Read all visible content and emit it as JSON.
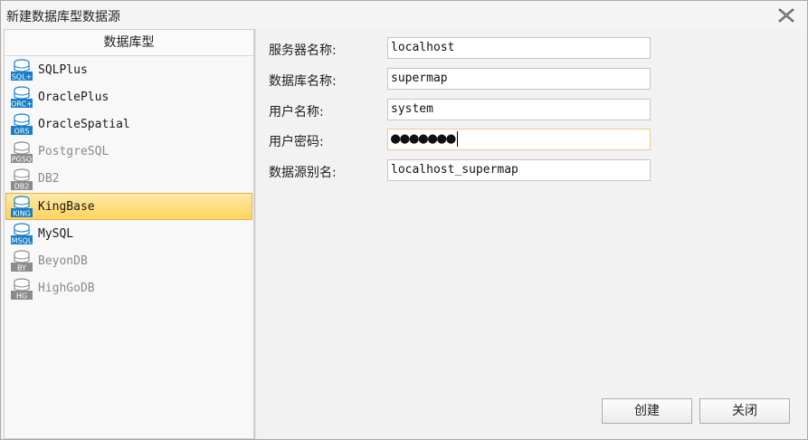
{
  "window": {
    "title": "新建数据库型数据源"
  },
  "left_panel": {
    "header": "数据库型",
    "items": [
      {
        "label": "SQLPlus",
        "badge": "SQL+",
        "enabled": true,
        "selected": false
      },
      {
        "label": "OraclePlus",
        "badge": "ORC+",
        "enabled": true,
        "selected": false
      },
      {
        "label": "OracleSpatial",
        "badge": "ORS",
        "enabled": true,
        "selected": false
      },
      {
        "label": "PostgreSQL",
        "badge": "PGSQ",
        "enabled": false,
        "selected": false
      },
      {
        "label": "DB2",
        "badge": "DB2",
        "enabled": false,
        "selected": false
      },
      {
        "label": "KingBase",
        "badge": "KING",
        "enabled": true,
        "selected": true
      },
      {
        "label": "MySQL",
        "badge": "MSQL",
        "enabled": true,
        "selected": false
      },
      {
        "label": "BeyonDB",
        "badge": "BY",
        "enabled": false,
        "selected": false
      },
      {
        "label": "HighGoDB",
        "badge": "HG",
        "enabled": false,
        "selected": false
      }
    ]
  },
  "form": {
    "server_label": "服务器名称:",
    "server_value": "localhost",
    "database_label": "数据库名称:",
    "database_value": "supermap",
    "user_label": "用户名称:",
    "user_value": "system",
    "password_label": "用户密码:",
    "password_mask": "●●●●●●●",
    "alias_label": "数据源别名:",
    "alias_value": "localhost_supermap"
  },
  "buttons": {
    "create": "创建",
    "close": "关闭"
  },
  "colors": {
    "selected_bg": "#ffd45e",
    "enabled_icon": "#1a7fc8",
    "disabled_icon": "#8c8c8c"
  }
}
